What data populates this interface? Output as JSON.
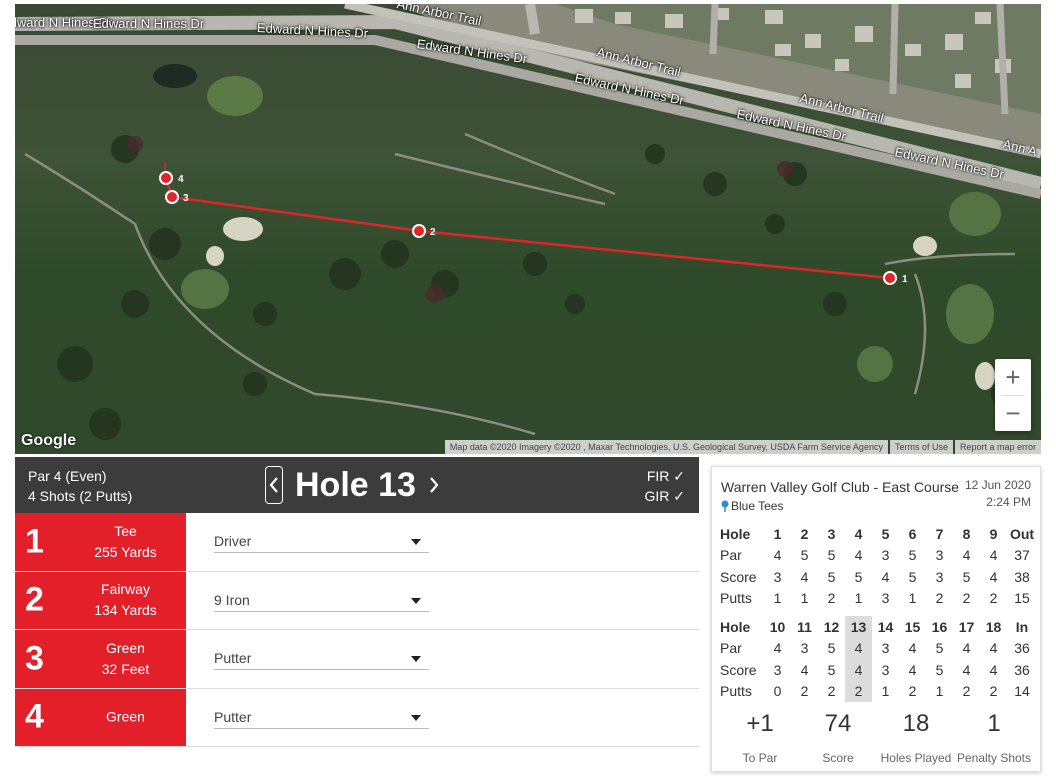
{
  "map": {
    "google_logo": "Google",
    "road_labels": [
      "Edward N Hines Dr",
      "Edward N Hines Dr",
      "Edward N Hines Dr",
      "Edward N Hines Dr",
      "Edward N Hines Dr",
      "Edward N Hines Dr",
      "Edward N Hines Dr",
      "Ann Arbor Trail",
      "Ann Arbor Trail",
      "Ann Arbor Trail",
      "Ann A"
    ],
    "markers": [
      "1",
      "2",
      "3",
      "4"
    ],
    "attribution": {
      "data": "Map data ©2020 Imagery ©2020 , Maxar Technologies, U.S. Geological Survey, USDA Farm Service Agency",
      "terms": "Terms of Use",
      "report": "Report a map error"
    },
    "zoom_in": "+",
    "zoom_out": "−"
  },
  "hole": {
    "par_text": "Par 4 (Even)",
    "shots_text": "4 Shots (2 Putts)",
    "title": "Hole 13",
    "fir": "FIR ✓",
    "gir": "GIR ✓"
  },
  "shots": [
    {
      "num": "1",
      "lie": "Tee",
      "distance": "255 Yards",
      "club": "Driver"
    },
    {
      "num": "2",
      "lie": "Fairway",
      "distance": "134 Yards",
      "club": "9 Iron"
    },
    {
      "num": "3",
      "lie": "Green",
      "distance": "32 Feet",
      "club": "Putter"
    },
    {
      "num": "4",
      "lie": "Green",
      "distance": "",
      "club": "Putter"
    }
  ],
  "scorecard": {
    "course": "Warren Valley Golf Club - East Course",
    "tees": "Blue Tees",
    "date": "12 Jun 2020",
    "time": "2:24 PM",
    "front": {
      "hole": [
        "Hole",
        "1",
        "2",
        "3",
        "4",
        "5",
        "6",
        "7",
        "8",
        "9",
        "Out"
      ],
      "par": [
        "Par",
        "4",
        "5",
        "5",
        "4",
        "3",
        "5",
        "3",
        "4",
        "4",
        "37"
      ],
      "score": [
        "Score",
        "3",
        "4",
        "5",
        "5",
        "4",
        "5",
        "3",
        "5",
        "4",
        "38"
      ],
      "putts": [
        "Putts",
        "1",
        "1",
        "2",
        "1",
        "3",
        "1",
        "2",
        "2",
        "2",
        "15"
      ]
    },
    "back": {
      "hole": [
        "Hole",
        "10",
        "11",
        "12",
        "13",
        "14",
        "15",
        "16",
        "17",
        "18",
        "In"
      ],
      "par": [
        "Par",
        "4",
        "3",
        "5",
        "4",
        "3",
        "4",
        "5",
        "4",
        "4",
        "36"
      ],
      "score": [
        "Score",
        "3",
        "4",
        "5",
        "4",
        "3",
        "4",
        "5",
        "4",
        "4",
        "36"
      ],
      "putts": [
        "Putts",
        "0",
        "2",
        "2",
        "2",
        "1",
        "2",
        "1",
        "2",
        "2",
        "14"
      ]
    },
    "stats": [
      {
        "value": "+1",
        "label": "To Par"
      },
      {
        "value": "74",
        "label": "Score"
      },
      {
        "value": "18",
        "label": "Holes Played"
      },
      {
        "value": "1",
        "label": "Penalty Shots"
      }
    ]
  }
}
